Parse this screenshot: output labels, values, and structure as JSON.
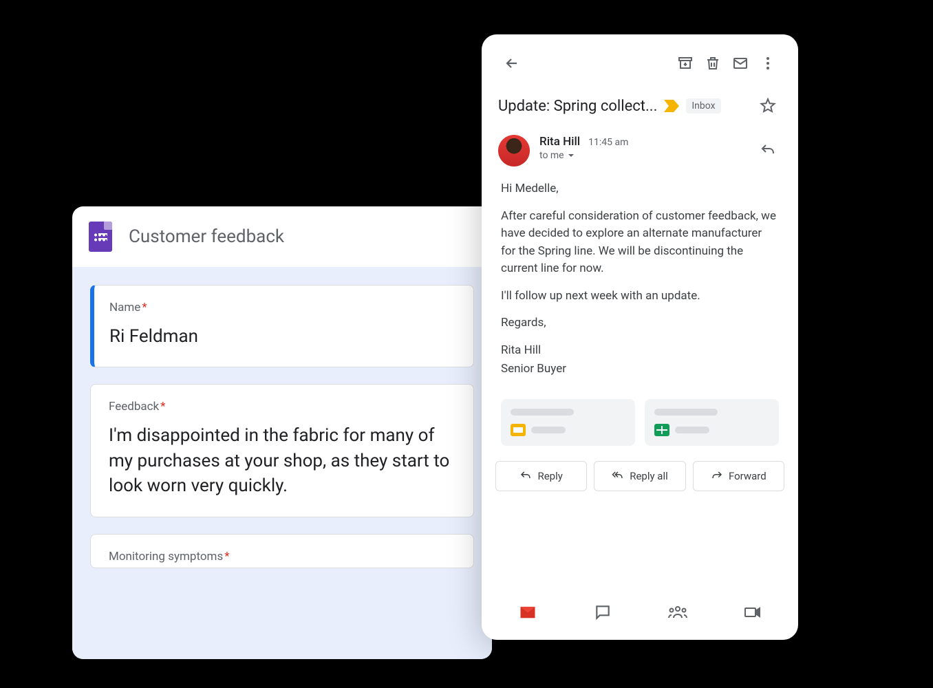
{
  "forms": {
    "title": "Customer feedback",
    "questions": [
      {
        "label": "Name",
        "required": true,
        "value": "Ri Feldman"
      },
      {
        "label": "Feedback",
        "required": true,
        "value": "I'm disappointed in the fabric for many of my purchases at your shop, as they start to look worn very quickly."
      },
      {
        "label": "Monitoring symptoms",
        "required": true,
        "value": ""
      }
    ]
  },
  "gmail": {
    "subject": "Update: Spring collect...",
    "inbox_chip": "Inbox",
    "sender": {
      "name": "Rita Hill",
      "time": "11:45 am",
      "to": "to me"
    },
    "body": {
      "greeting": "Hi Medelle,",
      "p1": "After careful consideration of customer feedback, we have decided to explore an alternate manufacturer for the Spring line. We will be discontinuing the current line for now.",
      "p2": "I'll follow up next week with an update.",
      "signoff": "Regards,",
      "sig_name": "Rita Hill",
      "sig_title": "Senior Buyer"
    },
    "actions": {
      "reply": "Reply",
      "reply_all": "Reply all",
      "forward": "Forward"
    }
  }
}
